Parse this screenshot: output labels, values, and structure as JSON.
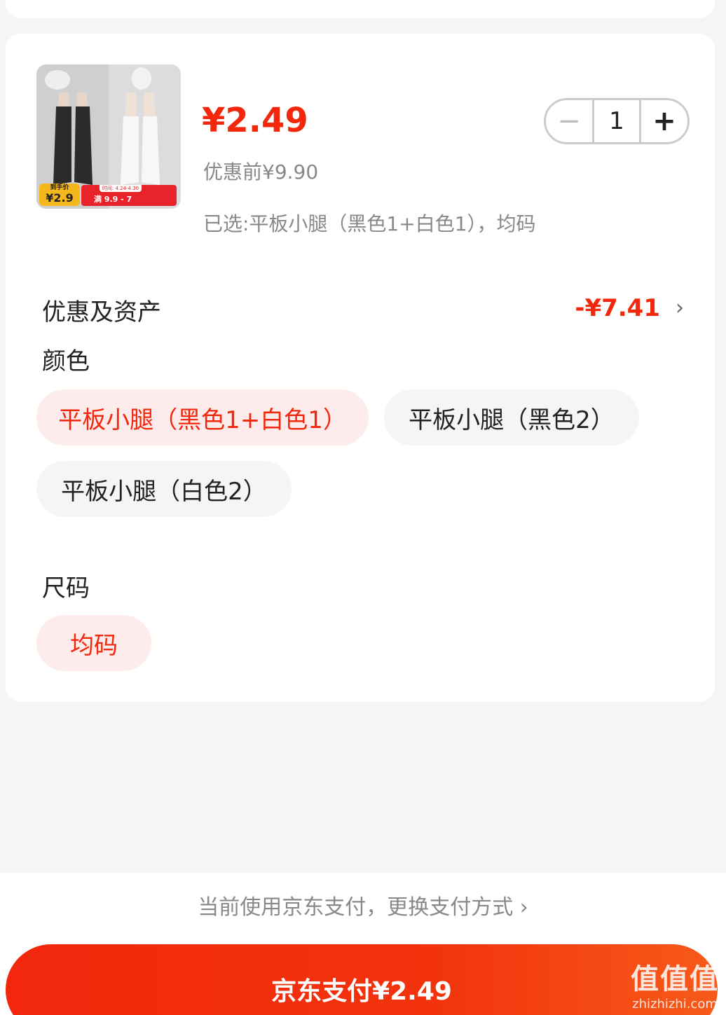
{
  "product": {
    "price": "¥2.49",
    "original_price": "优惠前¥9.90",
    "selected": "已选:平板小腿（黑色1+白色1），均码",
    "thumb_tag_label": "到手价",
    "thumb_tag_price": "¥2.9",
    "thumb_banner_date": "时间: 4.24-4.30",
    "thumb_banner_offer": "满 9.9  -  7"
  },
  "quantity": {
    "minus": "−",
    "value": "1",
    "plus": "+"
  },
  "discount": {
    "label": "优惠及资产",
    "value": "-¥7.41",
    "chevron": "›"
  },
  "color": {
    "title": "颜色",
    "options": [
      {
        "label": "平板小腿（黑色1+白色1）",
        "selected": true
      },
      {
        "label": "平板小腿（黑色2）",
        "selected": false
      },
      {
        "label": "平板小腿（白色2）",
        "selected": false
      }
    ]
  },
  "size": {
    "title": "尺码",
    "options": [
      {
        "label": "均码",
        "selected": true
      }
    ]
  },
  "payment": {
    "switch_text": "当前使用京东支付，更换支付方式 ›",
    "pay_button": "京东支付¥2.49"
  },
  "watermark": {
    "logo": "值值值",
    "site": "zhizhizhi.com"
  },
  "colors": {
    "accent": "#f2270c",
    "chip_active_bg": "#fdeceb",
    "chip_bg": "#f5f5f5"
  }
}
